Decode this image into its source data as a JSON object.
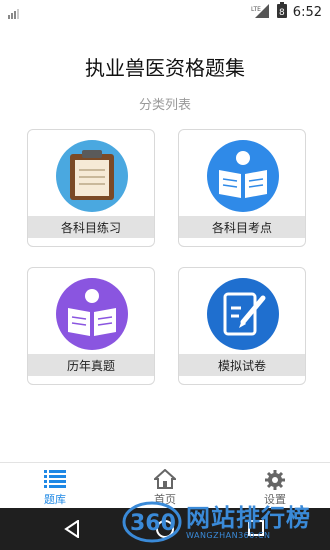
{
  "status_bar": {
    "time": "6:52",
    "battery_level": "8"
  },
  "header": {
    "title": "执业兽医资格题集",
    "subtitle": "分类列表"
  },
  "categories": [
    {
      "label": "各科目练习",
      "icon": "clipboard-icon",
      "color": "#4aa8e0"
    },
    {
      "label": "各科目考点",
      "icon": "reader-icon",
      "color": "#2f8ae8"
    },
    {
      "label": "历年真题",
      "icon": "reader-icon",
      "color": "#8a55e0"
    },
    {
      "label": "模拟试卷",
      "icon": "exam-paper-icon",
      "color": "#1f6fcf"
    }
  ],
  "tabs": [
    {
      "label": "题库",
      "icon": "list-icon",
      "active": true
    },
    {
      "label": "首页",
      "icon": "home-icon",
      "active": false
    },
    {
      "label": "设置",
      "icon": "gear-icon",
      "active": false
    }
  ],
  "watermark": {
    "text": "网站排行榜",
    "url": "WANGZHAN360.CN",
    "logo": "360"
  },
  "colors": {
    "accent": "#1e88e5",
    "tab_inactive": "#666666",
    "card_label_bg": "#e2e2e2"
  }
}
